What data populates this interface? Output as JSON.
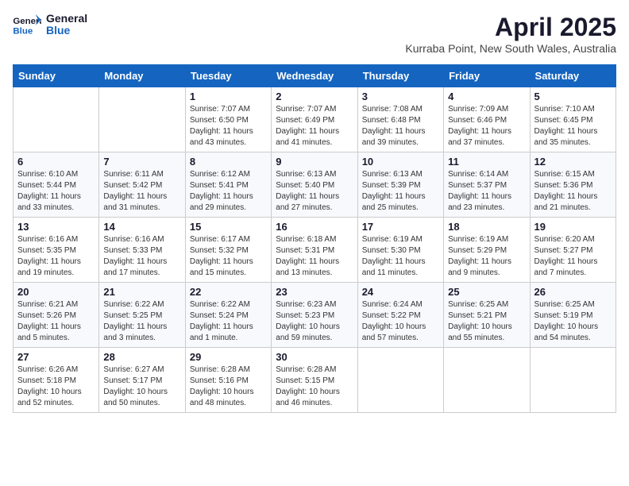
{
  "header": {
    "logo_line1": "General",
    "logo_line2": "Blue",
    "month_year": "April 2025",
    "location": "Kurraba Point, New South Wales, Australia"
  },
  "weekdays": [
    "Sunday",
    "Monday",
    "Tuesday",
    "Wednesday",
    "Thursday",
    "Friday",
    "Saturday"
  ],
  "weeks": [
    [
      {
        "day": "",
        "info": ""
      },
      {
        "day": "",
        "info": ""
      },
      {
        "day": "1",
        "info": "Sunrise: 7:07 AM\nSunset: 6:50 PM\nDaylight: 11 hours and 43 minutes."
      },
      {
        "day": "2",
        "info": "Sunrise: 7:07 AM\nSunset: 6:49 PM\nDaylight: 11 hours and 41 minutes."
      },
      {
        "day": "3",
        "info": "Sunrise: 7:08 AM\nSunset: 6:48 PM\nDaylight: 11 hours and 39 minutes."
      },
      {
        "day": "4",
        "info": "Sunrise: 7:09 AM\nSunset: 6:46 PM\nDaylight: 11 hours and 37 minutes."
      },
      {
        "day": "5",
        "info": "Sunrise: 7:10 AM\nSunset: 6:45 PM\nDaylight: 11 hours and 35 minutes."
      }
    ],
    [
      {
        "day": "6",
        "info": "Sunrise: 6:10 AM\nSunset: 5:44 PM\nDaylight: 11 hours and 33 minutes."
      },
      {
        "day": "7",
        "info": "Sunrise: 6:11 AM\nSunset: 5:42 PM\nDaylight: 11 hours and 31 minutes."
      },
      {
        "day": "8",
        "info": "Sunrise: 6:12 AM\nSunset: 5:41 PM\nDaylight: 11 hours and 29 minutes."
      },
      {
        "day": "9",
        "info": "Sunrise: 6:13 AM\nSunset: 5:40 PM\nDaylight: 11 hours and 27 minutes."
      },
      {
        "day": "10",
        "info": "Sunrise: 6:13 AM\nSunset: 5:39 PM\nDaylight: 11 hours and 25 minutes."
      },
      {
        "day": "11",
        "info": "Sunrise: 6:14 AM\nSunset: 5:37 PM\nDaylight: 11 hours and 23 minutes."
      },
      {
        "day": "12",
        "info": "Sunrise: 6:15 AM\nSunset: 5:36 PM\nDaylight: 11 hours and 21 minutes."
      }
    ],
    [
      {
        "day": "13",
        "info": "Sunrise: 6:16 AM\nSunset: 5:35 PM\nDaylight: 11 hours and 19 minutes."
      },
      {
        "day": "14",
        "info": "Sunrise: 6:16 AM\nSunset: 5:33 PM\nDaylight: 11 hours and 17 minutes."
      },
      {
        "day": "15",
        "info": "Sunrise: 6:17 AM\nSunset: 5:32 PM\nDaylight: 11 hours and 15 minutes."
      },
      {
        "day": "16",
        "info": "Sunrise: 6:18 AM\nSunset: 5:31 PM\nDaylight: 11 hours and 13 minutes."
      },
      {
        "day": "17",
        "info": "Sunrise: 6:19 AM\nSunset: 5:30 PM\nDaylight: 11 hours and 11 minutes."
      },
      {
        "day": "18",
        "info": "Sunrise: 6:19 AM\nSunset: 5:29 PM\nDaylight: 11 hours and 9 minutes."
      },
      {
        "day": "19",
        "info": "Sunrise: 6:20 AM\nSunset: 5:27 PM\nDaylight: 11 hours and 7 minutes."
      }
    ],
    [
      {
        "day": "20",
        "info": "Sunrise: 6:21 AM\nSunset: 5:26 PM\nDaylight: 11 hours and 5 minutes."
      },
      {
        "day": "21",
        "info": "Sunrise: 6:22 AM\nSunset: 5:25 PM\nDaylight: 11 hours and 3 minutes."
      },
      {
        "day": "22",
        "info": "Sunrise: 6:22 AM\nSunset: 5:24 PM\nDaylight: 11 hours and 1 minute."
      },
      {
        "day": "23",
        "info": "Sunrise: 6:23 AM\nSunset: 5:23 PM\nDaylight: 10 hours and 59 minutes."
      },
      {
        "day": "24",
        "info": "Sunrise: 6:24 AM\nSunset: 5:22 PM\nDaylight: 10 hours and 57 minutes."
      },
      {
        "day": "25",
        "info": "Sunrise: 6:25 AM\nSunset: 5:21 PM\nDaylight: 10 hours and 55 minutes."
      },
      {
        "day": "26",
        "info": "Sunrise: 6:25 AM\nSunset: 5:19 PM\nDaylight: 10 hours and 54 minutes."
      }
    ],
    [
      {
        "day": "27",
        "info": "Sunrise: 6:26 AM\nSunset: 5:18 PM\nDaylight: 10 hours and 52 minutes."
      },
      {
        "day": "28",
        "info": "Sunrise: 6:27 AM\nSunset: 5:17 PM\nDaylight: 10 hours and 50 minutes."
      },
      {
        "day": "29",
        "info": "Sunrise: 6:28 AM\nSunset: 5:16 PM\nDaylight: 10 hours and 48 minutes."
      },
      {
        "day": "30",
        "info": "Sunrise: 6:28 AM\nSunset: 5:15 PM\nDaylight: 10 hours and 46 minutes."
      },
      {
        "day": "",
        "info": ""
      },
      {
        "day": "",
        "info": ""
      },
      {
        "day": "",
        "info": ""
      }
    ]
  ]
}
